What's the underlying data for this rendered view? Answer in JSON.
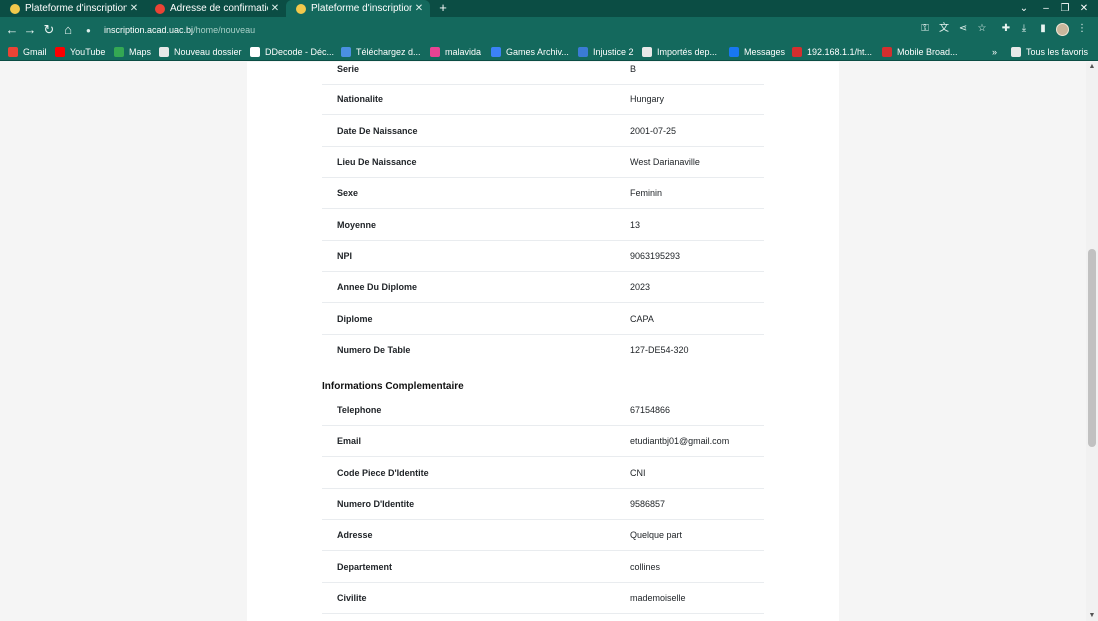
{
  "tabs": [
    {
      "title": "Plateforme d'inscription",
      "fav_color": "#f2c94c"
    },
    {
      "title": "Adresse de confirmation",
      "fav_color": "#ea4335"
    },
    {
      "title": "Plateforme d'inscription",
      "fav_color": "#f2c94c"
    }
  ],
  "toolbar": {
    "host": "inscription.acad.uac.bj",
    "path": "/home/nouveau"
  },
  "bookmarks": [
    {
      "label": "Gmail",
      "color": "#ea4335"
    },
    {
      "label": "YouTube",
      "color": "#ff0000"
    },
    {
      "label": "Maps",
      "color": "#34a853"
    },
    {
      "label": "Nouveau dossier",
      "color": "#e8e8e8"
    },
    {
      "label": "DDecode - Déc...",
      "color": "#ffffff"
    },
    {
      "label": "Téléchargez d...",
      "color": "#4a90e2"
    },
    {
      "label": "malavida",
      "color": "#e84393"
    },
    {
      "label": "Games Archiv...",
      "color": "#3b82f6"
    },
    {
      "label": "Injustice 2",
      "color": "#3a7bd5"
    },
    {
      "label": "Importés dep...",
      "color": "#e8e8e8"
    },
    {
      "label": "Messages",
      "color": "#1877f2"
    },
    {
      "label": "192.168.1.1/ht...",
      "color": "#d32f2f"
    },
    {
      "label": "Mobile Broad...",
      "color": "#d32f2f"
    },
    {
      "label": "Tous les favoris",
      "color": "#e8e8e8"
    }
  ],
  "bookmarks_overflow": "»",
  "academic": [
    {
      "key": "Serie",
      "value": "B"
    },
    {
      "key": "Nationalite",
      "value": "Hungary"
    },
    {
      "key": "Date De Naissance",
      "value": "2001-07-25"
    },
    {
      "key": "Lieu De Naissance",
      "value": "West Darianaville"
    },
    {
      "key": "Sexe",
      "value": "Feminin"
    },
    {
      "key": "Moyenne",
      "value": "13"
    },
    {
      "key": "NPI",
      "value": "9063195293"
    },
    {
      "key": "Annee Du Diplome",
      "value": "2023"
    },
    {
      "key": "Diplome",
      "value": "CAPA"
    },
    {
      "key": "Numero De Table",
      "value": "127-DE54-320"
    }
  ],
  "complementary_title": "Informations Complementaire",
  "complementary": [
    {
      "key": "Telephone",
      "value": "67154866"
    },
    {
      "key": "Email",
      "value": "etudiantbj01@gmail.com"
    },
    {
      "key": "Code Piece D'Identite",
      "value": "CNI"
    },
    {
      "key": "Numero D'Identite",
      "value": "9586857"
    },
    {
      "key": "Adresse",
      "value": "Quelque part"
    },
    {
      "key": "Departement",
      "value": "collines"
    },
    {
      "key": "Civilite",
      "value": "mademoiselle"
    }
  ]
}
